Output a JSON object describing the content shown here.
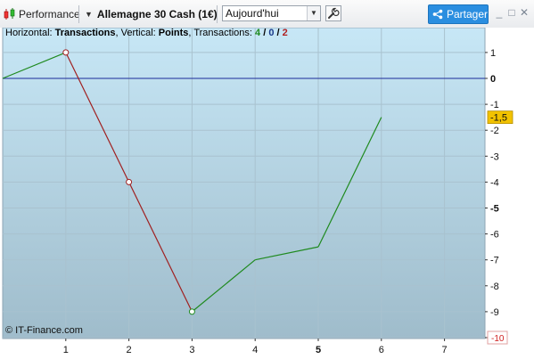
{
  "toolbar": {
    "performance_label": "Performance",
    "instrument_label": "Allemagne 30 Cash (1€)",
    "period_value": "Aujourd'hui",
    "share_label": "Partager",
    "minimize_symbol": "_",
    "maximize_symbol": "□",
    "close_symbol": "✕"
  },
  "info": {
    "horizontal_prefix": "Horizontal: ",
    "horizontal_value": "Transactions",
    "vertical_prefix": ", Vertical: ",
    "vertical_value": "Points",
    "transactions_prefix": ", Transactions: ",
    "wins": "4",
    "neutral": "0",
    "losses": "2",
    "slash": " / "
  },
  "footer": {
    "copyright": "© IT-Finance.com"
  },
  "colors": {
    "gain_line": "#1f8a1f",
    "loss_line": "#a02020",
    "zero_line": "#1a2a9a",
    "price_tag_bg": "#f2c200",
    "min_tag_color": "#d02020",
    "share_bg": "#2a8ee0"
  },
  "icons": {
    "performance": "candlestick-icon",
    "wrench": "wrench-icon",
    "share": "share-icon"
  },
  "chart_data": {
    "type": "line",
    "x": [
      0,
      1,
      2,
      3,
      4,
      5,
      6
    ],
    "y": [
      0,
      1,
      -4,
      -9,
      -7,
      -6.5,
      -1.5
    ],
    "segment_result": [
      "gain",
      "loss",
      "loss",
      "gain",
      "gain",
      "gain"
    ],
    "marked_points": [
      1,
      2,
      3
    ],
    "xlim": [
      0,
      7.6
    ],
    "ylim": [
      -10,
      2
    ],
    "x_ticks": [
      1,
      2,
      3,
      4,
      5,
      6,
      7
    ],
    "x_tick_labels": [
      "1",
      "2",
      "3",
      "4",
      "5",
      "6",
      "7"
    ],
    "x_bold_tick": "5",
    "y_ticks": [
      1,
      0,
      -1,
      -2,
      -3,
      -4,
      -5,
      -6,
      -7,
      -8,
      -9,
      -10
    ],
    "y_tick_labels": [
      "1",
      "0",
      "-1",
      "-2",
      "-3",
      "-4",
      "-5",
      "-6",
      "-7",
      "-8",
      "-9",
      "-10"
    ],
    "y_bold_ticks": [
      "0",
      "-5"
    ],
    "current_value_label": "-1,5",
    "current_value": -1.5,
    "min_label": "-10",
    "zero_line": 0,
    "grid": true
  }
}
